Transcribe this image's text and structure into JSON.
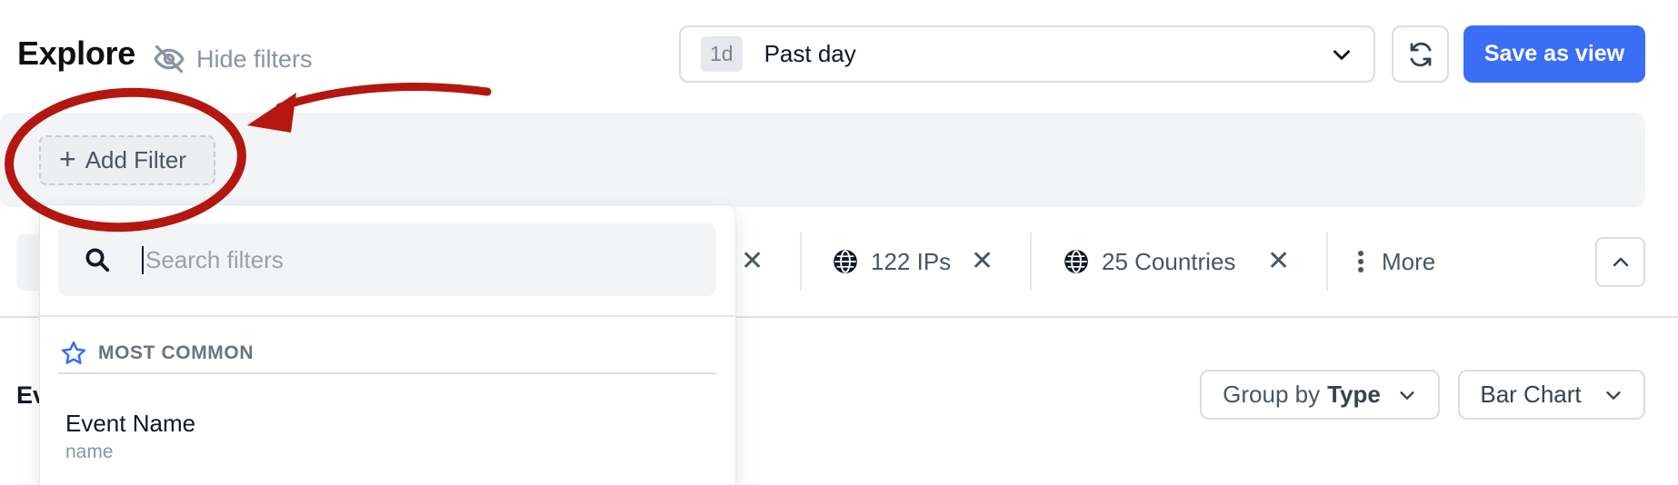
{
  "header": {
    "title": "Explore",
    "hide_filters_label": "Hide filters",
    "time_range": {
      "badge": "1d",
      "label": "Past day"
    },
    "save_label": "Save as view"
  },
  "filters": {
    "add_filter_label": "Add Filter",
    "chips": [
      {
        "icon": "globe-icon",
        "label": "122 IPs"
      },
      {
        "icon": "globe-icon",
        "label": "25 Countries"
      }
    ],
    "more_label": "More"
  },
  "dropdown": {
    "search_placeholder": "Search filters",
    "section_title": "MOST COMMON",
    "items": [
      {
        "name": "Event Name",
        "key": "name"
      }
    ]
  },
  "toolbar": {
    "heading_partial": "Ev",
    "group_prefix": "Group by",
    "group_value": "Type",
    "chart_type": "Bar Chart"
  },
  "colors": {
    "accent": "#3a6ef6",
    "annotation": "#b3170f",
    "panel_bg": "#f3f4f6"
  }
}
